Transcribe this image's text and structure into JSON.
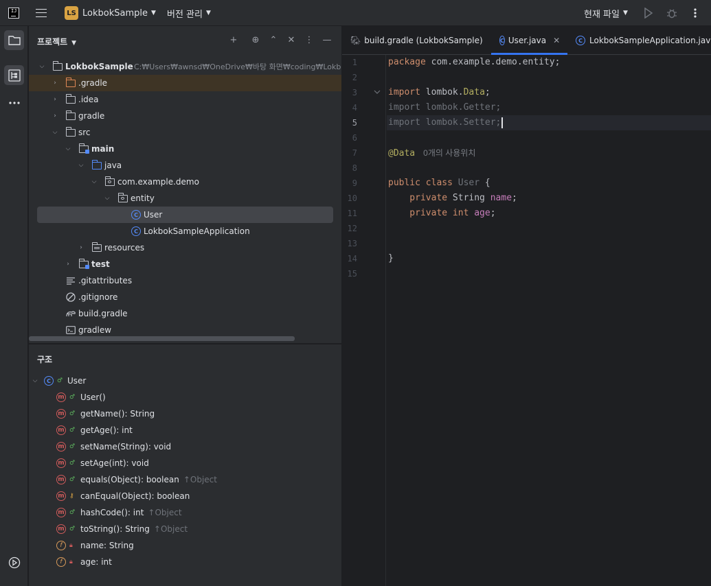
{
  "titlebar": {
    "project_badge": "LS",
    "project_name": "LokbokSample",
    "vcs_menu": "버전 관리",
    "run_config": "현재 파일"
  },
  "project_panel": {
    "title": "프로젝트",
    "tree": [
      {
        "label": "LokbokSample",
        "path": "C:₩Users₩awnsd₩OneDrive₩바탕 화면₩coding₩LokbokS",
        "depth": 0,
        "expanded": true,
        "icon": "folder-icon",
        "bold": true
      },
      {
        "label": ".gradle",
        "depth": 1,
        "expanded": false,
        "icon": "folder-excluded-icon"
      },
      {
        "label": ".idea",
        "depth": 1,
        "expanded": false,
        "icon": "folder-icon"
      },
      {
        "label": "gradle",
        "depth": 1,
        "expanded": false,
        "icon": "folder-icon"
      },
      {
        "label": "src",
        "depth": 1,
        "expanded": true,
        "icon": "folder-icon"
      },
      {
        "label": "main",
        "depth": 2,
        "expanded": true,
        "icon": "module-folder-icon",
        "bold": true
      },
      {
        "label": "java",
        "depth": 3,
        "expanded": true,
        "icon": "source-folder-icon"
      },
      {
        "label": "com.example.demo",
        "depth": 4,
        "expanded": true,
        "icon": "package-icon"
      },
      {
        "label": "entity",
        "depth": 5,
        "expanded": true,
        "icon": "package-icon"
      },
      {
        "label": "User",
        "depth": 6,
        "icon": "class-icon",
        "selected": true
      },
      {
        "label": "LokbokSampleApplication",
        "depth": 6,
        "icon": "spring-class-icon"
      },
      {
        "label": "resources",
        "depth": 3,
        "expanded": false,
        "icon": "resources-folder-icon"
      },
      {
        "label": "test",
        "depth": 2,
        "expanded": false,
        "icon": "module-folder-icon",
        "bold": true
      },
      {
        "label": ".gitattributes",
        "depth": 1,
        "icon": "text-file-icon"
      },
      {
        "label": ".gitignore",
        "depth": 1,
        "icon": "ignore-file-icon"
      },
      {
        "label": "build.gradle",
        "depth": 1,
        "icon": "gradle-icon"
      },
      {
        "label": "gradlew",
        "depth": 1,
        "icon": "shell-script-icon"
      }
    ]
  },
  "structure_panel": {
    "title": "구조",
    "root": "User",
    "members": [
      {
        "label": "User()",
        "kind": "method",
        "visibility": "public",
        "extra": ""
      },
      {
        "label": "getName(): String",
        "kind": "method",
        "visibility": "public",
        "extra": ""
      },
      {
        "label": "getAge(): int",
        "kind": "method",
        "visibility": "public",
        "extra": ""
      },
      {
        "label": "setName(String): void",
        "kind": "method",
        "visibility": "public",
        "extra": ""
      },
      {
        "label": "setAge(int): void",
        "kind": "method",
        "visibility": "public",
        "extra": ""
      },
      {
        "label": "equals(Object): boolean",
        "kind": "method",
        "visibility": "public",
        "extra": "↑Object"
      },
      {
        "label": "canEqual(Object): boolean",
        "kind": "method",
        "visibility": "protected",
        "extra": ""
      },
      {
        "label": "hashCode(): int",
        "kind": "method",
        "visibility": "public",
        "extra": "↑Object"
      },
      {
        "label": "toString(): String",
        "kind": "method",
        "visibility": "public",
        "extra": "↑Object"
      },
      {
        "label": "name: String",
        "kind": "field",
        "visibility": "private",
        "extra": ""
      },
      {
        "label": "age: int",
        "kind": "field",
        "visibility": "private",
        "extra": ""
      }
    ]
  },
  "editor": {
    "tabs": [
      {
        "label": "build.gradle (LokbokSample)",
        "icon": "gradle-icon",
        "active": false
      },
      {
        "label": "User.java",
        "icon": "class-icon",
        "active": true
      },
      {
        "label": "LokbokSampleApplication.java",
        "icon": "class-icon",
        "active": false
      }
    ],
    "current_line": 5,
    "line_numbers": [
      "1",
      "2",
      "3",
      "4",
      "5",
      "6",
      "7",
      "8",
      "9",
      "10",
      "11",
      "12",
      "13",
      "14",
      "15"
    ],
    "code": {
      "l1_kw": "package",
      "l1_rest": " com.example.demo.entity;",
      "l3_kw": "import",
      "l3_pkg": " lombok.",
      "l3_cls": "Data",
      "l3_end": ";",
      "l4": "import lombok.Getter;",
      "l5": "import lombok.Setter;",
      "l7_ann": "@Data",
      "l7_hint": "0개의 사용위치",
      "l9_kw": "public class",
      "l9_name": " User",
      "l9_end": " {",
      "l10_kw": "    private",
      "l10_type": " String",
      "l10_field": " name",
      "l10_end": ";",
      "l11_kw": "    private int",
      "l11_field": " age",
      "l11_end": ";",
      "l14": "}"
    }
  },
  "colors": {
    "accent": "#3574f0",
    "keyword": "#cf8e6d",
    "annotation": "#b3ae60",
    "field": "#c77dbb",
    "background": "#1e1f22",
    "panel": "#2b2d30"
  }
}
